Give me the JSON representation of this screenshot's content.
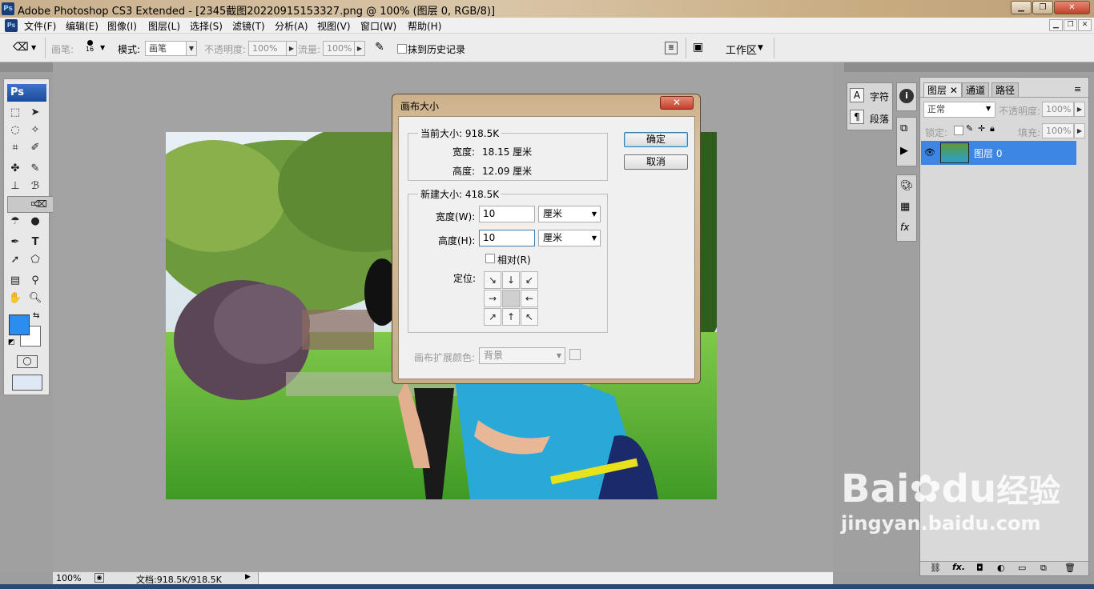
{
  "window": {
    "title": "Adobe Photoshop CS3 Extended - [2345截图20220915153327.png @ 100% (图层 0, RGB/8)]",
    "app_icon_text": "Ps"
  },
  "menubar": {
    "items": [
      "文件(F)",
      "编辑(E)",
      "图像(I)",
      "图层(L)",
      "选择(S)",
      "滤镜(T)",
      "分析(A)",
      "视图(V)",
      "窗口(W)",
      "帮助(H)"
    ]
  },
  "options_bar": {
    "brush_label": "画笔:",
    "brush_size": "16",
    "mode_label": "模式:",
    "mode_value": "画笔",
    "opacity_label": "不透明度:",
    "opacity_value": "100%",
    "flow_label": "流量:",
    "flow_value": "100%",
    "erase_history_label": "抹到历史记录",
    "workspace_label": "工作区"
  },
  "toolbox": {
    "logo": "Ps",
    "foreground_color": "#2b8df0",
    "background_color": "#ffffff"
  },
  "status_bar": {
    "zoom": "100%",
    "doc_info": "文档:918.5K/918.5K"
  },
  "dock": {
    "char_label": "字符",
    "para_label": "段落"
  },
  "layers_panel": {
    "tabs": [
      "图层",
      "通道",
      "路径"
    ],
    "blend_mode": "正常",
    "opacity_label": "不透明度:",
    "opacity_value": "100%",
    "lock_label": "锁定:",
    "fill_label": "填充:",
    "fill_value": "100%",
    "layer_name": "图层 0"
  },
  "dialog": {
    "title": "画布大小",
    "current_size_label": "当前大小: 918.5K",
    "width_label": "宽度:",
    "width_value": "18.15 厘米",
    "height_label": "高度:",
    "height_value": "12.09 厘米",
    "new_size_label": "新建大小: 418.5K",
    "new_width_label": "宽度(W):",
    "new_width_value": "10",
    "new_height_label": "高度(H):",
    "new_height_value": "10",
    "unit": "厘米",
    "relative_label": "相对(R)",
    "anchor_label": "定位:",
    "ext_color_label": "画布扩展颜色:",
    "ext_color_value": "背景",
    "ok_label": "确定",
    "cancel_label": "取消",
    "anchor_arrows": [
      "↘",
      "↓",
      "↙",
      "→",
      "",
      "←",
      "↗",
      "↑",
      "↖"
    ]
  },
  "watermark": {
    "brand": "Bai",
    "brand2": "du",
    "brand_cn": "经验",
    "url": "jingyan.baidu.com"
  }
}
